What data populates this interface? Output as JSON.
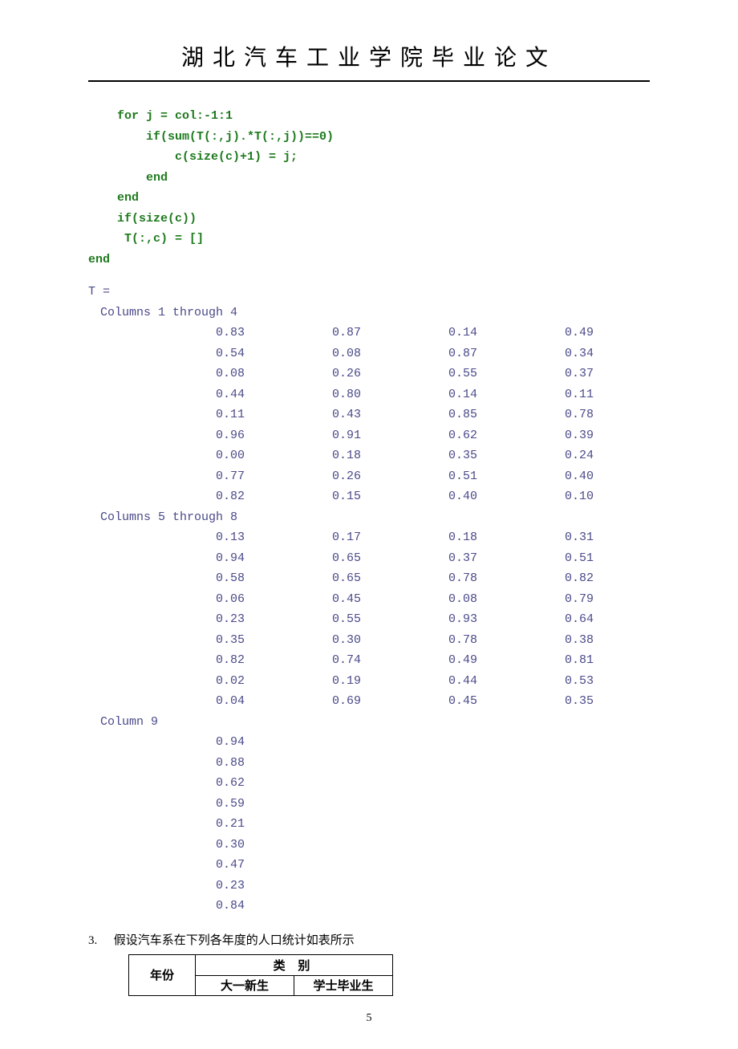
{
  "header": {
    "title": "湖北汽车工业学院毕业论文"
  },
  "code": {
    "l1": "    for j = col:-1:1",
    "l2": "        if(sum(T(:,j).*T(:,j))==0)",
    "l3": "            c(size(c)+1) = j;",
    "l4": "        end",
    "l5": "    end",
    "l6": "    if(size(c))",
    "l7": "     T(:,c) = []",
    "l8": "end"
  },
  "output": {
    "var": "T =",
    "header1": "Columns 1 through 4",
    "block1": [
      [
        "0.83",
        "0.87",
        "0.14",
        "0.49"
      ],
      [
        "0.54",
        "0.08",
        "0.87",
        "0.34"
      ],
      [
        "0.08",
        "0.26",
        "0.55",
        "0.37"
      ],
      [
        "0.44",
        "0.80",
        "0.14",
        "0.11"
      ],
      [
        "0.11",
        "0.43",
        "0.85",
        "0.78"
      ],
      [
        "0.96",
        "0.91",
        "0.62",
        "0.39"
      ],
      [
        "0.00",
        "0.18",
        "0.35",
        "0.24"
      ],
      [
        "0.77",
        "0.26",
        "0.51",
        "0.40"
      ],
      [
        "0.82",
        "0.15",
        "0.40",
        "0.10"
      ]
    ],
    "header2": "Columns 5 through 8",
    "block2": [
      [
        "0.13",
        "0.17",
        "0.18",
        "0.31"
      ],
      [
        "0.94",
        "0.65",
        "0.37",
        "0.51"
      ],
      [
        "0.58",
        "0.65",
        "0.78",
        "0.82"
      ],
      [
        "0.06",
        "0.45",
        "0.08",
        "0.79"
      ],
      [
        "0.23",
        "0.55",
        "0.93",
        "0.64"
      ],
      [
        "0.35",
        "0.30",
        "0.78",
        "0.38"
      ],
      [
        "0.82",
        "0.74",
        "0.49",
        "0.81"
      ],
      [
        "0.02",
        "0.19",
        "0.44",
        "0.53"
      ],
      [
        "0.04",
        "0.69",
        "0.45",
        "0.35"
      ]
    ],
    "header3": "Column 9",
    "block3": [
      [
        "0.94"
      ],
      [
        "0.88"
      ],
      [
        "0.62"
      ],
      [
        "0.59"
      ],
      [
        "0.21"
      ],
      [
        "0.30"
      ],
      [
        "0.47"
      ],
      [
        "0.23"
      ],
      [
        "0.84"
      ]
    ]
  },
  "question": {
    "num": "3.",
    "text": "假设汽车系在下列各年度的人口统计如表所示"
  },
  "table": {
    "year": "年份",
    "category": "类 别",
    "sub1": "大一新生",
    "sub2": "学士毕业生"
  },
  "pagenum": "5"
}
